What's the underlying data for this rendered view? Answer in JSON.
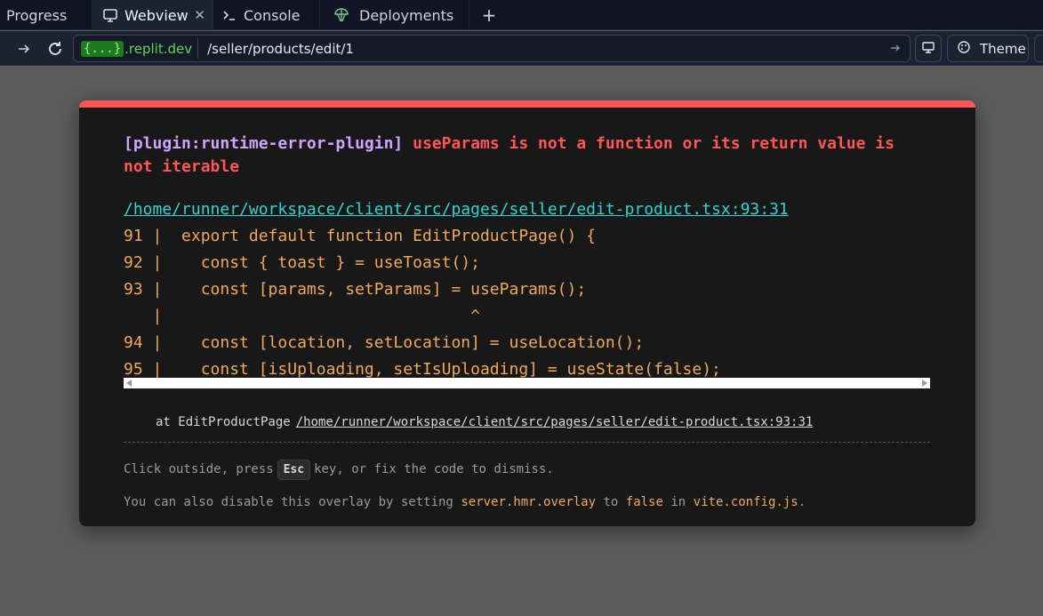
{
  "tabs": [
    {
      "label": "Progress",
      "icon": "none",
      "active": false
    },
    {
      "label": "Webview",
      "icon": "monitor-icon",
      "active": true
    },
    {
      "label": "Console",
      "icon": "terminal-prompt-icon",
      "active": false
    },
    {
      "label": "Deployments",
      "icon": "deploy-balloon-icon",
      "active": false
    }
  ],
  "tab_close": "✕",
  "new_tab": "+",
  "address": {
    "domain_chip": "{...}",
    "domain_host": ".replit.dev",
    "path": "/seller/products/edit/1"
  },
  "toolbar": {
    "theme_label": "Theme"
  },
  "error": {
    "plugin": "[plugin:runtime-error-plugin]",
    "message": "useParams is not a function or its return value is not iterable",
    "file": "/home/runner/workspace/client/src/pages/seller/edit-product.tsx:93:31",
    "frame_lines": [
      "91 |  export default function EditProductPage() {",
      "92 |    const { toast } = useToast();",
      "93 |    const [params, setParams] = useParams();",
      "   |                                ^",
      "94 |    const [location, setLocation] = useLocation();",
      "95 |    const [isUploading, setIsUploading] = useState(false);"
    ],
    "stack_prefix": "at EditProductPage",
    "stack_location": "/home/runner/workspace/client/src/pages/seller/edit-product.tsx:93:31",
    "tip1_before": "Click outside, press",
    "tip1_key": "Esc",
    "tip1_after": "key, or fix the code to dismiss.",
    "tip2_a": "You can also disable this overlay by setting",
    "tip2_b": "server.hmr.overlay",
    "tip2_c": "to",
    "tip2_d": "false",
    "tip2_e": "in",
    "tip2_f": "vite.config.js",
    "tip2_g": "."
  },
  "colors": {
    "error_red": "#ff5555",
    "plugin_purple": "#cfa4ff",
    "file_cyan": "#2dd4d4",
    "code_orange": "#f0a85a"
  }
}
